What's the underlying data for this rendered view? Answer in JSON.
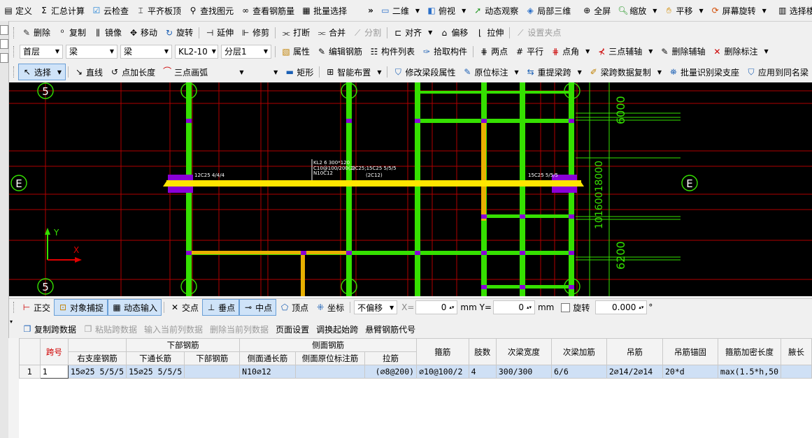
{
  "toolbar1": {
    "items": [
      {
        "icon": "define-icon",
        "label": "定义"
      },
      {
        "icon": "sigma-icon",
        "label": "汇总计算"
      },
      {
        "icon": "cloud-check-icon",
        "label": "云检查"
      },
      {
        "icon": "flat-slab-icon",
        "label": "平齐板顶"
      },
      {
        "icon": "binoculars-icon",
        "label": "查找图元"
      },
      {
        "icon": "eyeglasses-icon",
        "label": "查看钢筋量"
      },
      {
        "icon": "batch-select-icon",
        "label": "批量选择"
      }
    ],
    "overflow": "»",
    "view_items": [
      {
        "icon": "2d-icon",
        "label": "二维"
      },
      {
        "icon": "top-view-icon",
        "label": "俯视"
      },
      {
        "icon": "orbit-icon",
        "label": "动态观察"
      },
      {
        "icon": "local-3d-icon",
        "label": "局部三维"
      },
      {
        "icon": "fullscreen-icon",
        "label": "全屏"
      },
      {
        "icon": "zoom-icon",
        "label": "缩放"
      },
      {
        "icon": "pan-icon",
        "label": "平移"
      },
      {
        "icon": "screen-rotate-icon",
        "label": "屏幕旋转"
      },
      {
        "icon": "select-floor-icon",
        "label": "选择楼层"
      }
    ]
  },
  "toolbar2": {
    "items": [
      {
        "icon": "delete-icon",
        "label": "删除",
        "disabled": false
      },
      {
        "icon": "copy-icon",
        "label": "复制",
        "disabled": false
      },
      {
        "icon": "mirror-icon",
        "label": "镜像",
        "disabled": false
      },
      {
        "icon": "move-icon",
        "label": "移动",
        "disabled": false
      },
      {
        "icon": "rotate-icon",
        "label": "旋转",
        "disabled": false
      },
      {
        "icon": "extend-icon",
        "label": "延伸",
        "disabled": false
      },
      {
        "icon": "trim-icon",
        "label": "修剪",
        "disabled": false
      },
      {
        "icon": "break-icon",
        "label": "打断",
        "disabled": false
      },
      {
        "icon": "merge-icon",
        "label": "合并",
        "disabled": false
      },
      {
        "icon": "split-icon",
        "label": "分割",
        "disabled": true
      },
      {
        "icon": "align-icon",
        "label": "对齐",
        "disabled": false
      },
      {
        "icon": "offset-icon",
        "label": "偏移",
        "disabled": false
      },
      {
        "icon": "stretch-icon",
        "label": "拉伸",
        "disabled": false
      },
      {
        "icon": "set-grip-icon",
        "label": "设置夹点",
        "disabled": true
      }
    ]
  },
  "toolbar3": {
    "floor": "首层",
    "category": "梁",
    "type": "梁",
    "element": "KL2-10",
    "layer": "分层1",
    "items": [
      {
        "icon": "properties-icon",
        "label": "属性"
      },
      {
        "icon": "edit-rebar-icon",
        "label": "编辑钢筋"
      },
      {
        "icon": "component-list-icon",
        "label": "构件列表"
      },
      {
        "icon": "pick-component-icon",
        "label": "拾取构件"
      },
      {
        "icon": "two-points-icon",
        "label": "两点"
      },
      {
        "icon": "parallel-icon",
        "label": "平行"
      },
      {
        "icon": "point-angle-icon",
        "label": "点角"
      },
      {
        "icon": "three-point-axis-icon",
        "label": "三点辅轴"
      },
      {
        "icon": "delete-axis-icon",
        "label": "删除辅轴"
      },
      {
        "icon": "delete-dimension-icon",
        "label": "删除标注"
      }
    ]
  },
  "toolbar4": {
    "select": "选择",
    "line": "直线",
    "point_length": "点加长度",
    "arc": "三点画弧",
    "rect": "矩形",
    "smart_layout": "智能布置",
    "items": [
      {
        "icon": "modify-segment-icon",
        "label": "修改梁段属性"
      },
      {
        "icon": "in-situ-label-icon",
        "label": "原位标注"
      },
      {
        "icon": "re-extract-span-icon",
        "label": "重提梁跨"
      },
      {
        "icon": "copy-span-data-icon",
        "label": "梁跨数据复制"
      },
      {
        "icon": "batch-identify-icon",
        "label": "批量识别梁支座"
      },
      {
        "icon": "apply-same-icon",
        "label": "应用到同名梁"
      }
    ]
  },
  "cad": {
    "axis_labels": {
      "top_left": "5",
      "bottom_left": "5",
      "left_mid": "E",
      "right_mid": "E"
    },
    "beam_labels": {
      "left": "12C25 4/4/4",
      "middle1": "KL2 6 300*120",
      "middle2": "C10@100/200(2)",
      "middle3": "N10C12",
      "middle4": "(2C12)",
      "middle5": "2C25;15C25 5/5/5",
      "right": "15C25 5/5/5"
    },
    "dims": [
      "6000",
      "6200"
    ],
    "dim_stack": "10160018000",
    "axis_x": "X",
    "axis_y": "Y"
  },
  "snapbar": {
    "ortho": "正交",
    "snap": "对象捕捉",
    "dynamic": "动态输入",
    "intersection": "交点",
    "perpendicular": "垂点",
    "midpoint": "中点",
    "vertex": "顶点",
    "coordinate": "坐标",
    "offset_mode": "不偏移",
    "x_label": "X=",
    "x_value": "0",
    "y_label": "mm Y=",
    "y_value": "0",
    "mm": "mm",
    "rotate": "旋转",
    "rotate_value": "0.000",
    "deg": "°"
  },
  "gridtoolbar": {
    "items": [
      {
        "label": "复制跨数据",
        "disabled": false
      },
      {
        "label": "粘贴跨数据",
        "disabled": true
      },
      {
        "label": "输入当前列数据",
        "disabled": true
      },
      {
        "label": "删除当前列数据",
        "disabled": true
      },
      {
        "label": "页面设置",
        "disabled": false
      },
      {
        "label": "调换起始跨",
        "disabled": false
      },
      {
        "label": "悬臂钢筋代号",
        "disabled": false
      }
    ]
  },
  "grid": {
    "groups": {
      "span": "跨号",
      "lower": "下部钢筋",
      "side": "侧面钢筋"
    },
    "subheaders": {
      "right_support": "右支座钢筋",
      "lower_through": "下通长筋",
      "lower_rebar": "下部钢筋",
      "side_through": "侧面通长筋",
      "side_in_situ": "侧面原位标注筋",
      "tie": "拉筋",
      "stirrup": "箍筋",
      "legs": "肢数",
      "sub_beam_width": "次梁宽度",
      "sub_beam_add": "次梁加筋",
      "hanger": "吊筋",
      "hanger_anchor": "吊筋锚固",
      "stirrup_dense_len": "箍筋加密长度",
      "haunch_len": "腋长"
    },
    "rows": [
      {
        "rownum": "1",
        "span": "1",
        "right_support": "15⌀25 5/5/5",
        "lower_through": "15⌀25 5/5/5",
        "lower_rebar": "",
        "side_through": "N10⌀12",
        "side_in_situ": "",
        "tie": "(⌀8@200)",
        "stirrup": "⌀10@100/2",
        "legs": "4",
        "sub_beam_width": "300/300",
        "sub_beam_add": "6/6",
        "hanger": "2⌀14/2⌀14",
        "hanger_anchor": "20*d",
        "stirrup_dense_len": "max(1.5*h,50",
        "haunch_len": ""
      }
    ]
  },
  "colors": {
    "green": "#35e000",
    "yellow": "#ffe600",
    "orange": "#e8b000",
    "purple": "#8a00d8",
    "red": "#c00000",
    "selection": "#cfe0f5"
  }
}
